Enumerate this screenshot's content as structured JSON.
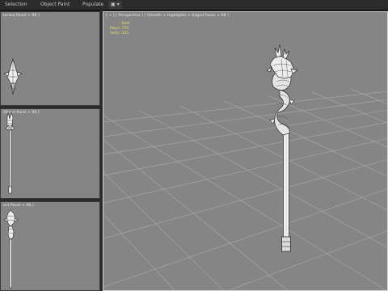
{
  "ribbon": {
    "tabs": [
      {
        "label": "Selection"
      },
      {
        "label": "Object Paint"
      },
      {
        "label": "Populate"
      },
      {
        "label": "▣ ▾"
      }
    ]
  },
  "viewports": {
    "top_left": {
      "label": "[ + ] [ Front ] [ Standard ] [ Default Shading ]",
      "shown": "lected Panel + 98 ]"
    },
    "mid_left": {
      "label": "[ + ] [ Left ] [ Standard ] [ Default Shading ]",
      "shown": "Object Paint + 98 ]"
    },
    "bottom_left": {
      "label": "[ + ] [ Top ] [ Standard ] [ Default Shading ]",
      "shown": "ect Panel + 98 ]"
    },
    "main": {
      "label": "[ + ] [ Perspective ] [ Smooth + Highlights + Edged Faces + 98 ]"
    }
  },
  "stats": {
    "total_label": "Total",
    "polys_label": "Polys:",
    "polys_value": "770",
    "verts_label": "Verts:",
    "verts_value": "335"
  },
  "colors": {
    "viewport_bg": "#858585",
    "grid_line": "#a3a3a3",
    "stats_text": "#e7e16a",
    "active_border": "#d4d4d4"
  }
}
